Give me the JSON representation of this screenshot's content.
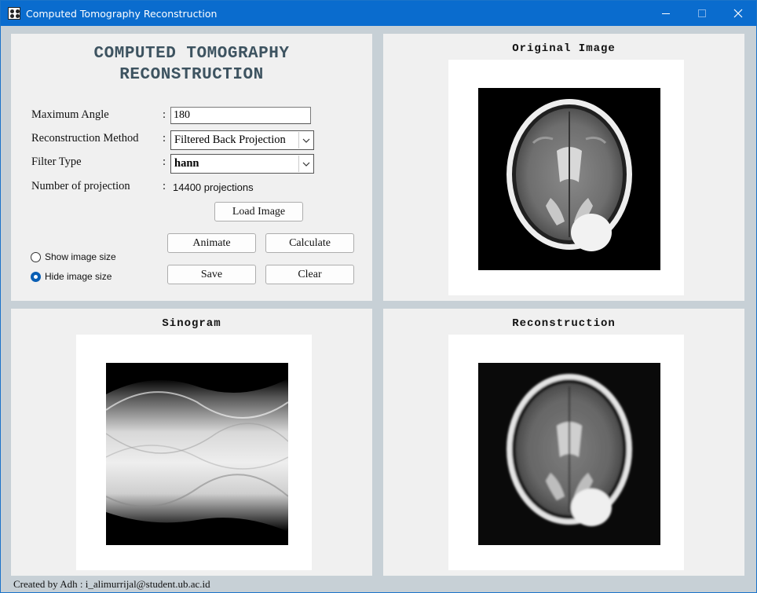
{
  "window": {
    "title": "Computed Tomography Reconstruction"
  },
  "controls": {
    "heading_line1": "COMPUTED TOMOGRAPHY",
    "heading_line2": "RECONSTRUCTION",
    "max_angle_label": "Maximum Angle",
    "max_angle_value": "180",
    "method_label": "Reconstruction Method",
    "method_value": "Filtered Back Projection",
    "filter_label": "Filter Type",
    "filter_value": "hann",
    "projections_label": "Number of projection",
    "projections_value": "14400 projections",
    "colon": ":",
    "load_label": "Load Image",
    "animate_label": "Animate",
    "calculate_label": "Calculate",
    "save_label": "Save",
    "clear_label": "Clear",
    "show_size_label": "Show image size",
    "hide_size_label": "Hide image size",
    "selected_size_option": "hide"
  },
  "panels": {
    "original_title": "Original Image",
    "sinogram_title": "Sinogram",
    "recon_title": "Reconstruction"
  },
  "footer": {
    "text": "Created by Adh : i_alimurrijal@student.ub.ac.id"
  },
  "colors": {
    "titlebar": "#0a6cce",
    "panel_bg": "#f0f0f0",
    "window_bg": "#c7d0d6",
    "heading_text": "#3d5360",
    "radio_accent": "#0a5fb4"
  },
  "icons": {
    "app": "app-icon",
    "minimize": "minimize-icon",
    "maximize": "maximize-icon",
    "close": "close-icon",
    "dropdown": "chevron-down-icon"
  }
}
